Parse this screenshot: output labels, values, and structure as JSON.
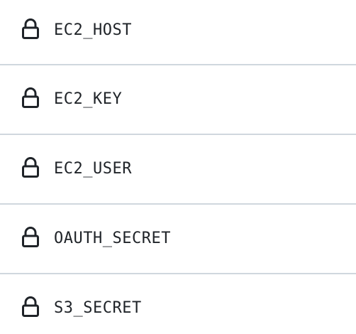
{
  "secrets": {
    "items": [
      {
        "name": "EC2_HOST",
        "icon": "lock-icon"
      },
      {
        "name": "EC2_KEY",
        "icon": "lock-icon"
      },
      {
        "name": "EC2_USER",
        "icon": "lock-icon"
      },
      {
        "name": "OAUTH_SECRET",
        "icon": "lock-icon"
      },
      {
        "name": "S3_SECRET",
        "icon": "lock-icon"
      }
    ]
  },
  "colors": {
    "text": "#1f2328",
    "divider": "#d0d7de",
    "background": "#ffffff"
  }
}
